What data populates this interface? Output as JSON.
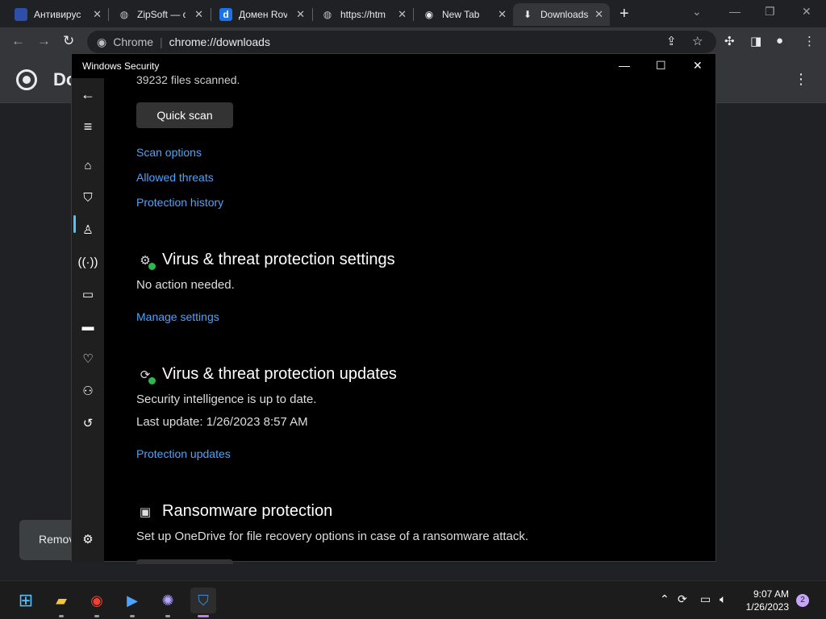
{
  "browser": {
    "tabs": [
      {
        "title": "Антивирус",
        "favicon": "antivirus-favicon"
      },
      {
        "title": "ZipSoft — с",
        "favicon": "globe-icon"
      },
      {
        "title": "Домен Rov",
        "favicon": "d-favicon"
      },
      {
        "title": "https://htm",
        "favicon": "globe-icon"
      },
      {
        "title": "New Tab",
        "favicon": "chrome-icon"
      },
      {
        "title": "Downloads",
        "favicon": "download-icon"
      }
    ],
    "omnibox": {
      "site": "Chrome",
      "url": "chrome://downloads"
    },
    "page_title": "Do",
    "remove_label": "Remov"
  },
  "security_window": {
    "title": "Windows Security",
    "scanned_text": "39232 files scanned.",
    "quick_scan_label": "Quick scan",
    "links": {
      "scan_options": "Scan options",
      "allowed_threats": "Allowed threats",
      "protection_history": "Protection history"
    },
    "settings": {
      "heading": "Virus & threat protection settings",
      "status": "No action needed.",
      "link": "Manage settings"
    },
    "updates": {
      "heading": "Virus & threat protection updates",
      "status": "Security intelligence is up to date.",
      "last_update": "Last update: 1/26/2023 8:57 AM",
      "link": "Protection updates"
    },
    "ransomware": {
      "heading": "Ransomware protection",
      "description": "Set up OneDrive for file recovery options in case of a ransomware attack."
    }
  },
  "taskbar": {
    "time": "9:07 AM",
    "date": "1/26/2023",
    "notifications": "2"
  },
  "colors": {
    "link": "#4da3ff",
    "accent": "#4cc2ff",
    "ok_green": "#2db84d"
  }
}
